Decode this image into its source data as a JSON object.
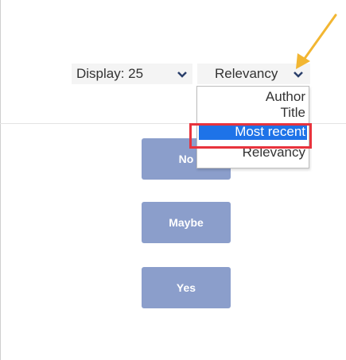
{
  "toolbar": {
    "display_label": "Display: 25",
    "sort_label": "Relevancy"
  },
  "sort_dropdown": {
    "options": [
      "Author",
      "Title",
      "Most recent",
      "Relevancy"
    ],
    "selected": "Most recent"
  },
  "buttons": {
    "no": "No",
    "maybe": "Maybe",
    "yes": "Yes"
  },
  "colors": {
    "button_bg": "#8b9ecb",
    "selected_option_bg": "#1e73e8",
    "highlight_border": "#e8333d",
    "arrow": "#f2b632"
  },
  "icons": {
    "dropdown_chevron": "chevron-down-icon",
    "annotation_arrow": "arrow-icon"
  }
}
